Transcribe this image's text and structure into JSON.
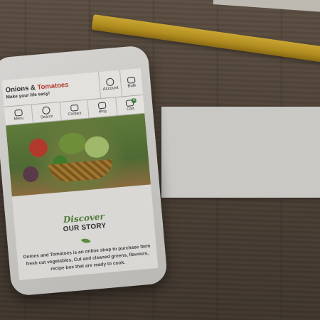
{
  "brand": {
    "name_part1": "Onions & ",
    "name_part2": "Tomatoes",
    "tagline": "Make your life easy!"
  },
  "header_buttons": [
    {
      "label": "Account",
      "icon": "user-circle-icon"
    },
    {
      "label": "Bulk",
      "icon": "crate-icon"
    }
  ],
  "nav": [
    {
      "label": "Menu",
      "icon": "menu-icon"
    },
    {
      "label": "Search",
      "icon": "search-icon"
    },
    {
      "label": "Contact",
      "icon": "phone-icon"
    },
    {
      "label": "Blog",
      "icon": "blog-icon"
    },
    {
      "label": "Cart",
      "icon": "basket-icon",
      "badge": "0"
    }
  ],
  "story": {
    "script": "Discover",
    "heading": "OUR STORY",
    "description": "Onions and Tomatoes is an online shop to purchase farm fresh cut vegetables, Cut and cleaned greens, flavours, recipe box that are ready to cook."
  }
}
